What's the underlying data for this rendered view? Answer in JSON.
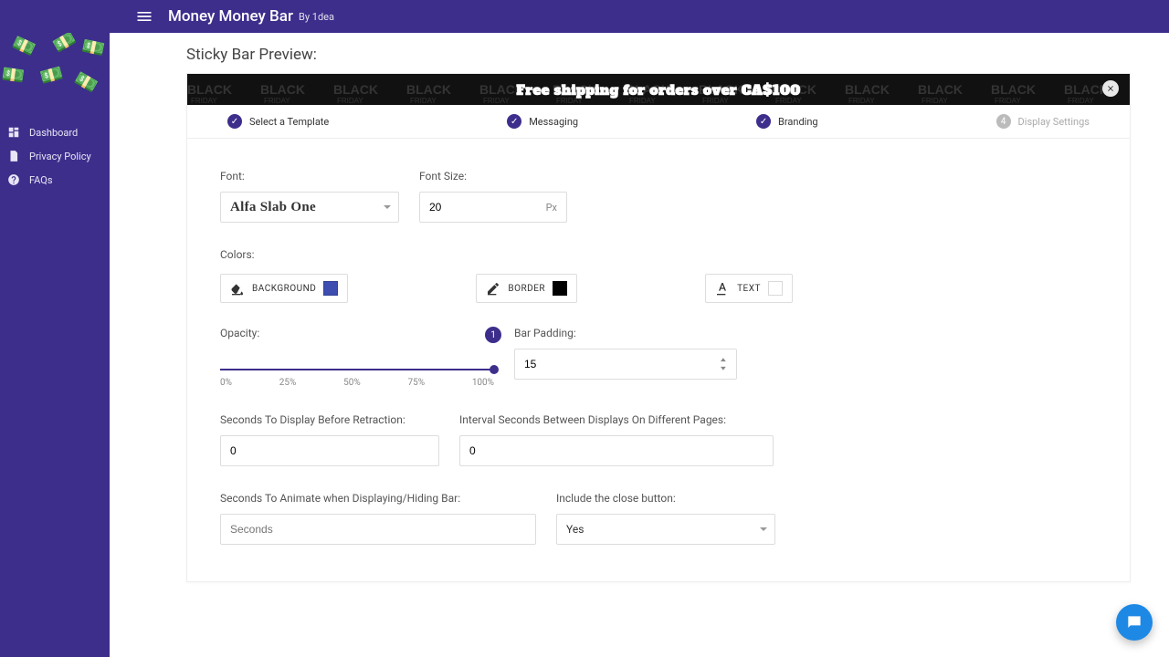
{
  "header": {
    "title": "Money Money Bar",
    "by": "By 1dea"
  },
  "sidebar": {
    "items": [
      {
        "label": "Dashboard"
      },
      {
        "label": "Privacy Policy"
      },
      {
        "label": "FAQs"
      }
    ]
  },
  "preview": {
    "heading": "Sticky Bar Preview:",
    "text": "Free shipping for orders over CA$100"
  },
  "stepper": [
    {
      "label": "Select a Template",
      "done": true
    },
    {
      "label": "Messaging",
      "done": true
    },
    {
      "label": "Branding",
      "done": true
    },
    {
      "label": "Display Settings",
      "done": false,
      "num": "4"
    }
  ],
  "form": {
    "font": {
      "label": "Font:",
      "value": "Alfa Slab One"
    },
    "font_size": {
      "label": "Font Size:",
      "value": "20",
      "suffix": "Px"
    },
    "colors_label": "Colors:",
    "colors": {
      "background": {
        "label": "BACKGROUND",
        "hex": "#3d4db0"
      },
      "border": {
        "label": "BORDER",
        "hex": "#000000"
      },
      "text": {
        "label": "TEXT",
        "hex": "#ffffff"
      }
    },
    "opacity": {
      "label": "Opacity:",
      "value": "1",
      "ticks": [
        "0%",
        "25%",
        "50%",
        "75%",
        "100%"
      ]
    },
    "padding": {
      "label": "Bar Padding:",
      "value": "15"
    },
    "secs_before": {
      "label": "Seconds To Display Before Retraction:",
      "value": "0"
    },
    "interval": {
      "label": "Interval Seconds Between Displays On Different Pages:",
      "value": "0"
    },
    "secs_anim": {
      "label": "Seconds To Animate when Displaying/Hiding Bar:",
      "placeholder": "Seconds"
    },
    "close_btn": {
      "label": "Include the close button:",
      "value": "Yes"
    }
  }
}
